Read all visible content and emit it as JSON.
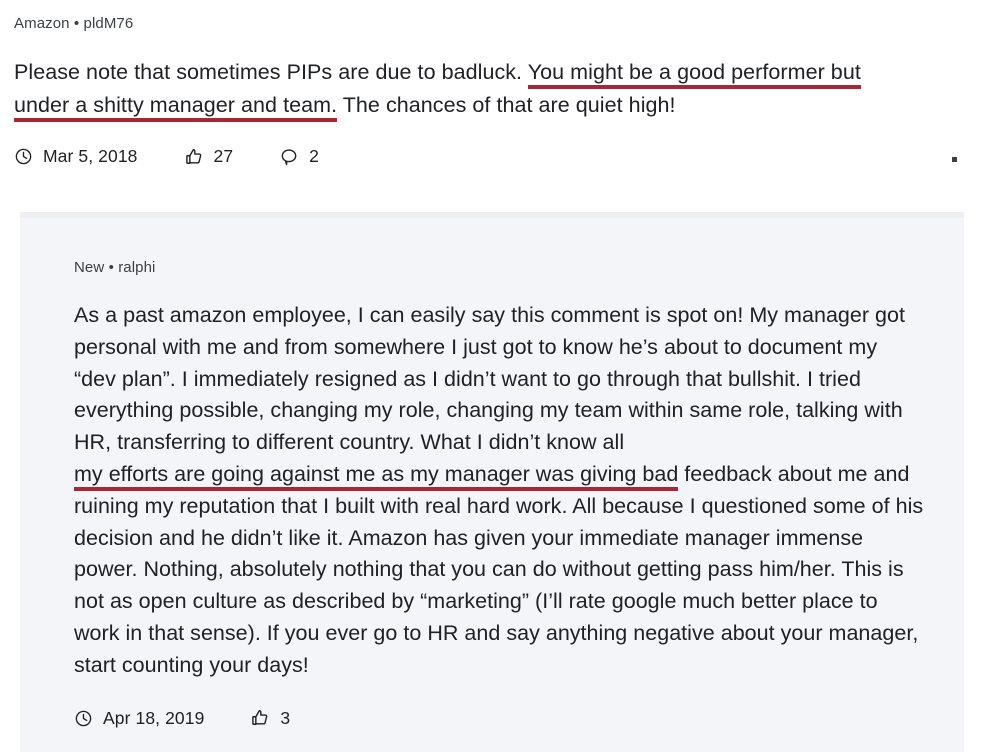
{
  "post": {
    "source": "Amazon • pldM76",
    "body_segments": [
      {
        "text": "Please note that sometimes PIPs are due to badluck. ",
        "highlight": false
      },
      {
        "text": "You might be a good performer but",
        "highlight": true
      },
      {
        "text": " ",
        "highlight": false
      },
      {
        "text": "under a shitty manager and team.",
        "highlight": true
      },
      {
        "text": " The chances of that are quiet high!",
        "highlight": false
      }
    ],
    "body_plain": "Please note that sometimes PIPs are due to badluck. You might be a good performer but under a shitty manager and team. The chances of that are quiet high!",
    "meta": {
      "date": "Mar 5, 2018",
      "date_icon": "clock-icon",
      "likes": "27",
      "likes_icon": "thumbs-up-icon",
      "comments": "2",
      "comments_icon": "comment-bubble-icon"
    }
  },
  "reply": {
    "source": "New • ralphi",
    "body_segments": [
      {
        "text": "As a past amazon employee, I can easily say this comment is spot on! My manager got personal with me and from somewhere I just got to know he’s about to document my “dev plan”. I immediately resigned as I didn’t want to go through that bullshit. I tried everything possible, changing my role, changing my team within same role, talking with HR, transferring to different country. What I didn’t know all ",
        "highlight": false
      },
      {
        "text": "my efforts are going against me as my manager was giving bad",
        "highlight": true
      },
      {
        "text": " feedback about me and ruining my reputation that I built with real hard work. All because I questioned some of his decision and he didn’t like it. Amazon has given your immediate manager immense power. Nothing, absolutely nothing that you can do without getting pass him/her. This is not as open culture as described by “marketing” (I’ll rate google much better place to work in that sense). If you ever go to HR and say anything negative about your manager, start counting your days!",
        "highlight": false
      }
    ],
    "meta": {
      "date": "Apr 18, 2019",
      "date_icon": "clock-icon",
      "likes": "3",
      "likes_icon": "thumbs-up-icon"
    }
  },
  "colors": {
    "highlight_underline": "#a52834",
    "panel_background": "#f4f5f9",
    "text": "#202124",
    "muted_text": "#3c4043"
  }
}
